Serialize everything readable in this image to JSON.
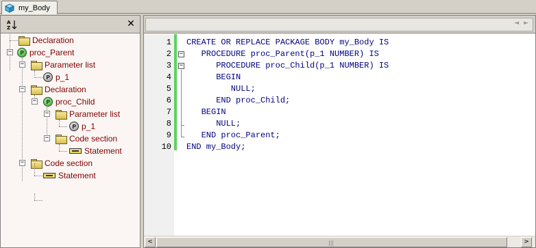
{
  "tab": {
    "label": "my_Body",
    "icon": "package-cube-icon"
  },
  "left_panel": {
    "sort_icon": "sort-az-icon",
    "close_icon": "close-icon",
    "sort_label": "A↓Z",
    "close_label": "✕"
  },
  "tree": {
    "nodes": [
      {
        "label": "Declaration",
        "icon": "folder-icon"
      },
      {
        "label": "proc_Parent",
        "icon": "procedure-icon",
        "expander": "−",
        "badge": "P"
      },
      {
        "label": "Parameter list",
        "icon": "folder-icon",
        "expander": "−"
      },
      {
        "label": "p_1",
        "icon": "parameter-icon",
        "badge": "P"
      },
      {
        "label": "Declaration",
        "icon": "folder-icon",
        "expander": "−"
      },
      {
        "label": "proc_Child",
        "icon": "procedure-icon",
        "expander": "−",
        "badge": "P"
      },
      {
        "label": "Parameter list",
        "icon": "folder-icon",
        "expander": "−"
      },
      {
        "label": "p_1",
        "icon": "parameter-icon",
        "badge": "P"
      },
      {
        "label": "Code section",
        "icon": "folder-icon",
        "expander": "−"
      },
      {
        "label": "Statement",
        "icon": "statement-icon"
      },
      {
        "label": "Code section",
        "icon": "folder-icon",
        "expander": "−"
      },
      {
        "label": "Statement",
        "icon": "statement-icon"
      }
    ]
  },
  "editor": {
    "line_numbers": [
      "1",
      "2",
      "3",
      "4",
      "5",
      "6",
      "7",
      "8",
      "9",
      "10"
    ],
    "lines": [
      "CREATE OR REPLACE PACKAGE BODY my_Body IS",
      "   PROCEDURE proc_Parent(p_1 NUMBER) IS",
      "      PROCEDURE proc_Child(p_1 NUMBER) IS",
      "      BEGIN",
      "         NULL;",
      "      END proc_Child;",
      "   BEGIN",
      "      NULL;",
      "   END proc_Parent;",
      "END my_Body;"
    ],
    "fold_markers": [
      "",
      "−",
      "−",
      "",
      "",
      "",
      "",
      "",
      "",
      ""
    ],
    "change_bar_color": "#5ed15e",
    "code_color": "#000080",
    "navigator_arrows": "◄ ►"
  },
  "scrollbar": {
    "left_arrow": "<",
    "right_arrow": ">",
    "grip": "|||"
  },
  "colors": {
    "tree_text": "#800000",
    "tree_background": "#fbf6f4",
    "chrome": "#d4d0c8"
  }
}
